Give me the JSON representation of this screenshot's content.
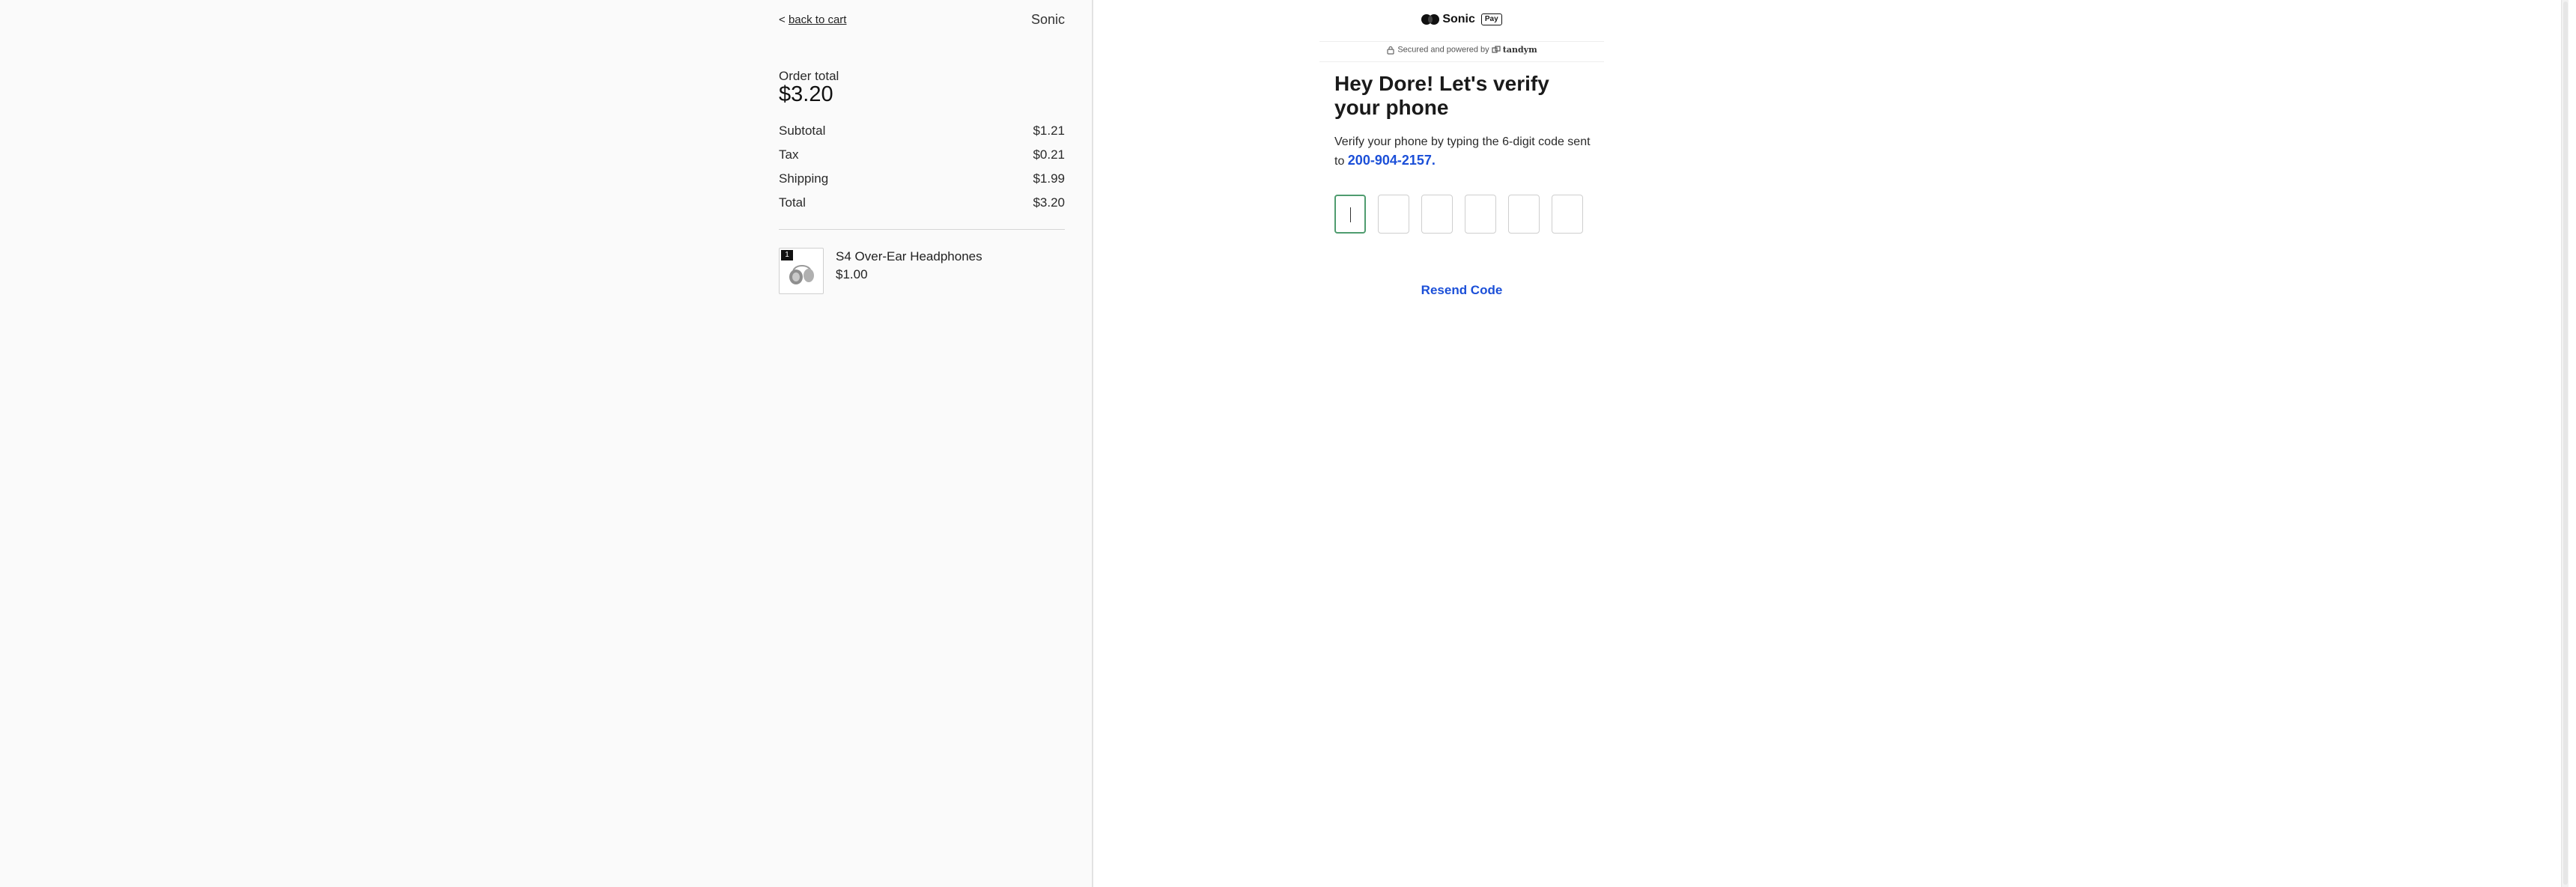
{
  "left": {
    "back_link": {
      "arrow": "<",
      "label": "back to cart"
    },
    "brand": "Sonic",
    "order_total_label": "Order total",
    "order_total_value": "$3.20",
    "summary": [
      {
        "label": "Subtotal",
        "value": "$1.21"
      },
      {
        "label": "Tax",
        "value": "$0.21"
      },
      {
        "label": "Shipping",
        "value": "$1.99"
      },
      {
        "label": "Total",
        "value": "$3.20"
      }
    ],
    "product": {
      "quantity": "1",
      "name": "S4 Over-Ear Headphones",
      "price": "$1.00",
      "image_icon": "headphones-icon"
    }
  },
  "right": {
    "logo": {
      "icon": "sonic-logo-icon",
      "word": "Sonic",
      "badge": "Pay"
    },
    "secured": {
      "icon": "lock-icon",
      "text": "Secured and powered by",
      "partner": "tandym",
      "partner_icon": "tandym-logo-icon"
    },
    "heading": "Hey Dore! Let's verify your phone",
    "subtext": "Verify your phone by typing the 6-digit code sent to",
    "phone": "200-904-2157",
    "phone_suffix": ".",
    "code_boxes": [
      "",
      "",
      "",
      "",
      "",
      ""
    ],
    "resend_label": "Resend Code",
    "colors": {
      "accent": "#1b4fd8",
      "focus_border": "#4f9c6f"
    }
  }
}
